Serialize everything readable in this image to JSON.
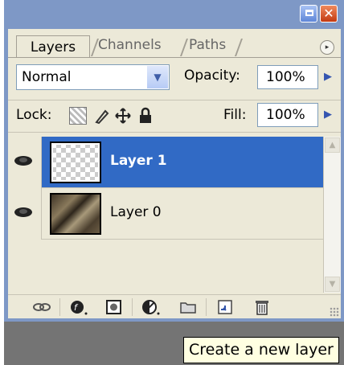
{
  "window": {
    "minimize_glyph": "",
    "close_glyph": "✕"
  },
  "tabs": [
    {
      "label": "Layers",
      "active": true
    },
    {
      "label": "Channels",
      "active": false
    },
    {
      "label": "Paths",
      "active": false
    }
  ],
  "panel_menu_icon": "▸",
  "blend_mode": {
    "value": "Normal",
    "arrow": "▼"
  },
  "opacity": {
    "label": "Opacity:",
    "value": "100%",
    "arrow": "▶"
  },
  "lock": {
    "label": "Lock:"
  },
  "fill": {
    "label": "Fill:",
    "value": "100%",
    "arrow": "▶"
  },
  "layers": [
    {
      "name": "Layer 1",
      "selected": true,
      "visible": true,
      "thumbnail": "transparent"
    },
    {
      "name": "Layer 0",
      "selected": false,
      "visible": true,
      "thumbnail": "photo"
    }
  ],
  "scroll": {
    "up": "▲",
    "down": "▼"
  },
  "toolbar_icons": [
    "link-icon",
    "layer-style-icon",
    "mask-icon",
    "adjustment-icon",
    "group-folder-icon",
    "new-layer-icon",
    "trash-icon"
  ],
  "tooltip": "Create a new layer",
  "colors": {
    "selection": "#316ac5",
    "panel": "#ece9d8",
    "title": "#7e98c6"
  }
}
